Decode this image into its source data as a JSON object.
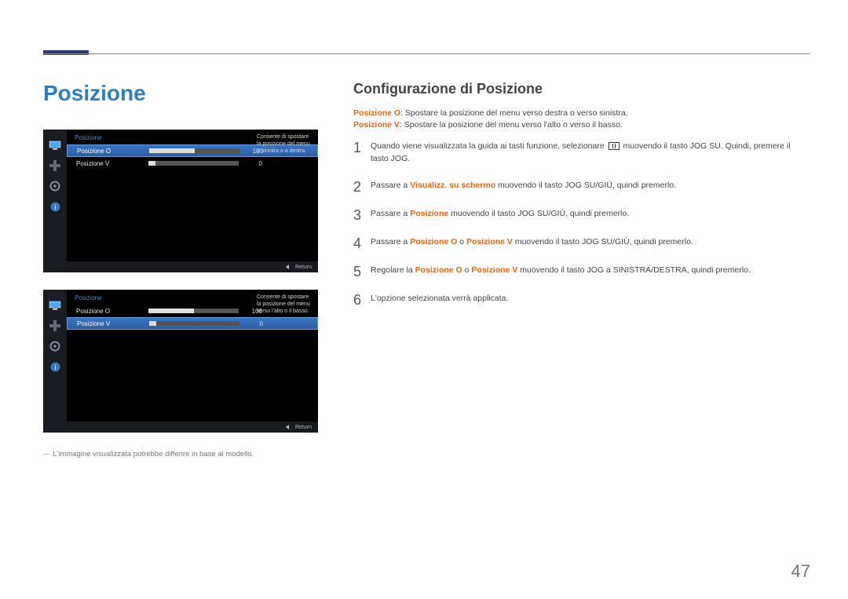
{
  "page_number": "47",
  "left": {
    "heading": "Posizione",
    "panel1": {
      "title": "Posizione",
      "rows": [
        {
          "label": "Posizione O",
          "value": "100",
          "fill": 50,
          "selected": true
        },
        {
          "label": "Posizione V",
          "value": "0",
          "fill": 8,
          "selected": false
        }
      ],
      "hint": "Consente di spostare la posizione del menu a sinistra o a destra.",
      "return": "Return"
    },
    "panel2": {
      "title": "Posizione",
      "rows": [
        {
          "label": "Posizione O",
          "value": "100",
          "fill": 50,
          "selected": false
        },
        {
          "label": "Posizione V",
          "value": "0",
          "fill": 8,
          "selected": true
        }
      ],
      "hint": "Consente di spostare la posizione del menu verso l'alto o il basso.",
      "return": "Return"
    },
    "note": "L'immagine visualizzata potrebbe differire in base al modello."
  },
  "right": {
    "heading": "Configurazione di Posizione",
    "intro": [
      {
        "hl": "Posizione O",
        "text": ": Spostare la posizione del menu verso destra o verso sinistra."
      },
      {
        "hl": "Posizione V",
        "text": ": Spostare la posizione del menu verso l'alto o verso il basso."
      }
    ],
    "steps": {
      "s1a": "Quando viene visualizzata la guida ai tasti funzione, selezionare ",
      "s1b": " muovendo il tasto JOG SU. Quindi, premere il tasto JOG.",
      "s2a": "Passare a ",
      "s2hl": "Visualizz. su schermo",
      "s2b": " muovendo il tasto JOG SU/GIÙ, quindi premerlo.",
      "s3a": "Passare a ",
      "s3hl": "Posizione",
      "s3b": " muovendo il tasto JOG SU/GIÙ, quindi premerlo.",
      "s4a": "Passare a ",
      "s4hl1": "Posizione O",
      "s4mid": " o ",
      "s4hl2": "Posizione V",
      "s4b": " muovendo il tasto JOG SU/GIÙ, quindi premerlo.",
      "s5a": "Regolare la ",
      "s5hl1": "Posizione O",
      "s5mid": " o ",
      "s5hl2": "Posizione V",
      "s5b": " muovendo il tasto JOG a SINISTRA/DESTRA, quindi premerlo.",
      "s6": "L'opzione selezionata verrà applicata."
    }
  }
}
